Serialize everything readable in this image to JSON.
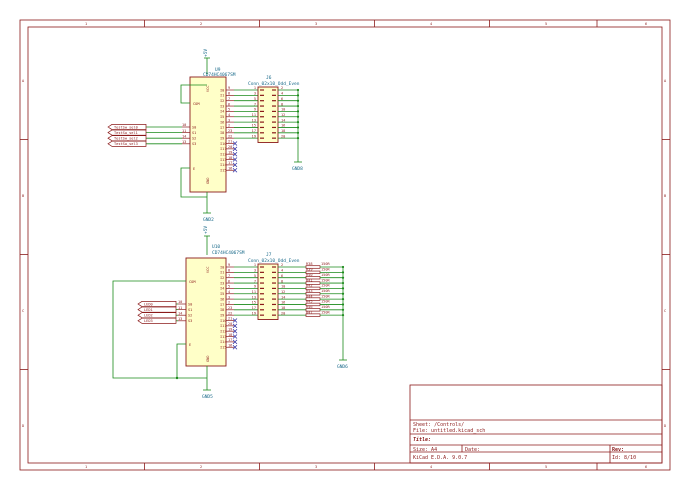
{
  "frame": {
    "col_marks": [
      "1",
      "2",
      "3",
      "4",
      "5",
      "6"
    ],
    "row_marks": [
      "A",
      "B",
      "C",
      "D"
    ]
  },
  "block1": {
    "ref": "U9",
    "value": "CD74HC4067SM",
    "power_label": "+5V",
    "vcc_label": "VCC",
    "gnd_label": "GND",
    "com_label": "COM",
    "e_label": "E",
    "gnd_flag": "GND2",
    "sel_pins": [
      "S0",
      "S1",
      "S2",
      "S3"
    ],
    "sel_nums": [
      "10",
      "11",
      "14",
      "13"
    ],
    "nets": [
      "TestSw_sel0",
      "TestSw_sel1",
      "TestSw_sel2",
      "TestSw_sel3"
    ],
    "ch_pins": [
      "I0",
      "I1",
      "I2",
      "I3",
      "I4",
      "I5",
      "I6",
      "I7",
      "I8",
      "I9",
      "I10",
      "I11",
      "I12",
      "I13",
      "I14",
      "I15"
    ],
    "ch_nums": [
      "9",
      "8",
      "7",
      "6",
      "5",
      "4",
      "3",
      "2",
      "23",
      "22",
      "21",
      "20",
      "19",
      "18",
      "17",
      "16"
    ],
    "conn_ref": "J6",
    "conn_value": "Conn_02x10_Odd_Even",
    "conn_left": [
      "1",
      "3",
      "5",
      "7",
      "9",
      "11",
      "13",
      "15",
      "17",
      "19"
    ],
    "conn_right": [
      "2",
      "4",
      "6",
      "8",
      "10",
      "12",
      "14",
      "16",
      "18",
      "20"
    ],
    "conn_gnd": "GND8"
  },
  "block2": {
    "ref": "U10",
    "value": "CD74HC4067SM",
    "power_label": "+5V",
    "vcc_label": "VCC",
    "gnd_label": "GND",
    "com_label": "COM",
    "e_label": "E",
    "gnd_flag": "GND5",
    "sel_pins": [
      "S0",
      "S1",
      "S2",
      "S3"
    ],
    "sel_nums": [
      "10",
      "11",
      "14",
      "13"
    ],
    "nets": [
      "LED0",
      "LED1",
      "LED2",
      "LED3"
    ],
    "ch_pins": [
      "I0",
      "I1",
      "I2",
      "I3",
      "I4",
      "I5",
      "I6",
      "I7",
      "I8",
      "I9",
      "I10",
      "I11",
      "I12",
      "I13",
      "I14",
      "I15"
    ],
    "ch_nums": [
      "9",
      "8",
      "7",
      "6",
      "5",
      "4",
      "3",
      "2",
      "23",
      "22",
      "21",
      "20",
      "19",
      "18",
      "17",
      "16"
    ],
    "conn_ref": "J7",
    "conn_value": "Conn_02x10_Odd_Even",
    "conn_left": [
      "1",
      "3",
      "5",
      "7",
      "9",
      "11",
      "13",
      "15",
      "17",
      "19"
    ],
    "conn_right": [
      "2",
      "4",
      "6",
      "8",
      "10",
      "12",
      "14",
      "16",
      "18",
      "20"
    ],
    "res_refs": [
      "R38",
      "R39",
      "R40",
      "R41",
      "R42",
      "R43",
      "R44",
      "R45",
      "R46",
      "R47"
    ],
    "res_values": [
      "150R",
      "150R",
      "150R",
      "150R",
      "150R",
      "150R",
      "150R",
      "150R",
      "150R",
      "150R"
    ],
    "res_gnd": "GND6"
  },
  "title_block": {
    "sheet": "Sheet: /Controls/",
    "file": "File: untitled.kicad_sch",
    "title": "Title:",
    "size": "Size: A4",
    "date": "Date:",
    "rev": "Rev:",
    "tool": "KiCad E.D.A. 9.0.7",
    "id": "Id: 8/10"
  }
}
